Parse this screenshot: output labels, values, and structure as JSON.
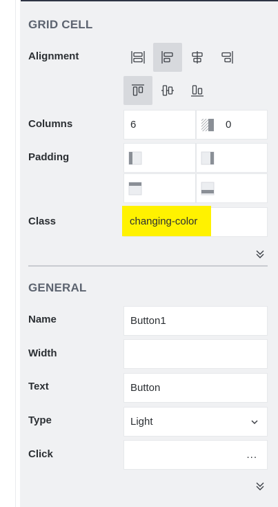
{
  "grid_cell": {
    "title": "GRID CELL",
    "alignment_label": "Alignment",
    "columns_label": "Columns",
    "columns_value": "6",
    "offset_value": "0",
    "padding_label": "Padding",
    "class_label": "Class",
    "class_value": "changing-color"
  },
  "general": {
    "title": "GENERAL",
    "name_label": "Name",
    "name_value": "Button1",
    "width_label": "Width",
    "width_value": "",
    "text_label": "Text",
    "text_value": "Button",
    "type_label": "Type",
    "type_value": "Light",
    "click_label": "Click",
    "click_value": "...",
    "click_button": "..."
  },
  "colors": {
    "panel_bg": "#f0f1f3",
    "highlight": "#fff200",
    "active_button": "#d7d9dd"
  }
}
